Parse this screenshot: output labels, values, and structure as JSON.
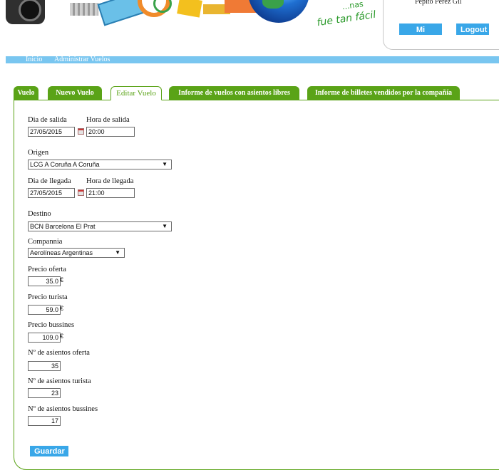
{
  "header": {
    "slogan_line1": "...nas",
    "slogan_line2": "fue tan fácil",
    "user_name": "Pepito Pérez Gil",
    "account_label": "Mi cuenta",
    "logout_label": "Logout"
  },
  "nav": {
    "items": [
      "Inicio",
      "Administrar Vuelos"
    ]
  },
  "tabs": [
    "Vuelo",
    "Nuevo Vuelo",
    "Editar Vuelo",
    "Informe de vuelos con asientos libres",
    "Informe de billetes vendidos por la compañía"
  ],
  "form": {
    "dia_salida_label": "Dia de salida",
    "hora_salida_label": "Hora de salida",
    "dia_salida": "27/05/2015",
    "hora_salida": "20:00",
    "origen_label": "Origen",
    "origen": "LCG A Coruña A Coruña",
    "dia_llegada_label": "Dia de llegada",
    "hora_llegada_label": "Hora de llegada",
    "dia_llegada": "27/05/2015",
    "hora_llegada": "21:00",
    "destino_label": "Destino",
    "destino": "BCN Barcelona El Prat",
    "compania_label": "Compannia",
    "compania": "Aerolíneas Argentinas",
    "precio_oferta_label": "Precio oferta",
    "precio_oferta": "35.0",
    "precio_turista_label": "Precio turista",
    "precio_turista": "59.0",
    "precio_bussines_label": "Precio bussines",
    "precio_bussines": "109.0",
    "currency": "€",
    "asientos_oferta_label": "Nº de asientos oferta",
    "asientos_oferta": "35",
    "asientos_turista_label": "Nº de asientos turista",
    "asientos_turista": "23",
    "asientos_bussines_label": "Nº de asientos bussines",
    "asientos_bussines": "17",
    "save_label": "Guardar"
  },
  "colors": {
    "tab_green": "#5aa317",
    "nav_blue": "#79c6f0",
    "button_blue": "#39a7e8"
  }
}
